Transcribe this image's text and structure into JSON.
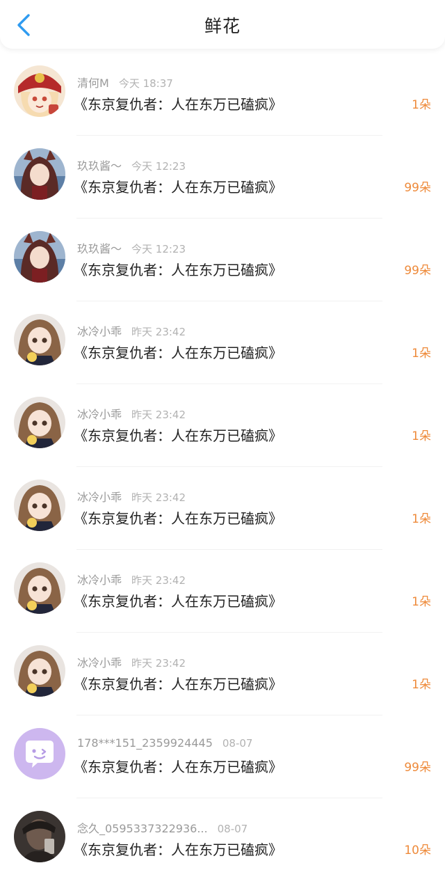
{
  "header": {
    "title": "鲜花",
    "back_icon": "chevron-left-icon",
    "accent_color": "#2f9bf0"
  },
  "colors": {
    "count": "#ee8a3a",
    "meta": "#9a9a9a"
  },
  "rows": [
    {
      "avatar": "avatar-anime-red-hat",
      "user": "清何M",
      "time": "今天 18:37",
      "book": "《东京复仇者：人在东万已磕疯》",
      "count": "1朵"
    },
    {
      "avatar": "avatar-anime-foxgirl",
      "user": "玖玖酱～",
      "time": "今天 12:23",
      "book": "《东京复仇者：人在东万已磕疯》",
      "count": "99朵"
    },
    {
      "avatar": "avatar-anime-foxgirl",
      "user": "玖玖酱～",
      "time": "今天 12:23",
      "book": "《东京复仇者：人在东万已磕疯》",
      "count": "99朵"
    },
    {
      "avatar": "avatar-anime-girl-brown-hair",
      "user": "冰冷小乖",
      "time": "昨天 23:42",
      "book": "《东京复仇者：人在东万已磕疯》",
      "count": "1朵"
    },
    {
      "avatar": "avatar-anime-girl-brown-hair",
      "user": "冰冷小乖",
      "time": "昨天 23:42",
      "book": "《东京复仇者：人在东万已磕疯》",
      "count": "1朵"
    },
    {
      "avatar": "avatar-anime-girl-brown-hair",
      "user": "冰冷小乖",
      "time": "昨天 23:42",
      "book": "《东京复仇者：人在东万已磕疯》",
      "count": "1朵"
    },
    {
      "avatar": "avatar-anime-girl-brown-hair",
      "user": "冰冷小乖",
      "time": "昨天 23:42",
      "book": "《东京复仇者：人在东万已磕疯》",
      "count": "1朵"
    },
    {
      "avatar": "avatar-anime-girl-brown-hair",
      "user": "冰冷小乖",
      "time": "昨天 23:42",
      "book": "《东京复仇者：人在东万已磕疯》",
      "count": "1朵"
    },
    {
      "avatar": "default-chat-bubble-avatar",
      "user": "178***151_2359924445",
      "time": "08-07",
      "book": "《东京复仇者：人在东万已磕疯》",
      "count": "99朵"
    },
    {
      "avatar": "avatar-dark-photo",
      "user": "念久_0595337322936...",
      "time": "08-07",
      "book": "《东京复仇者：人在东万已磕疯》",
      "count": "10朵"
    }
  ]
}
